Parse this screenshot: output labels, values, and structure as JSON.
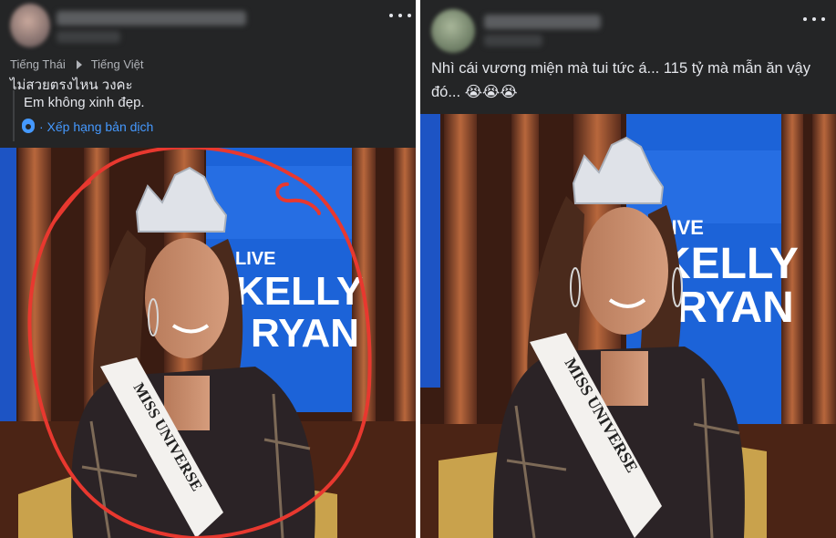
{
  "left_post": {
    "lang_from": "Tiếng Thái",
    "lang_to": "Tiếng Việt",
    "original_text": "ไม่สวยตรงไหน วงคะ",
    "translated_text": "Em không xinh đẹp.",
    "rate_translation": "· Xếp hạng bản dịch",
    "photo": {
      "backdrop_lines": [
        "LIVE",
        "KELLY",
        "RYAN"
      ],
      "sash_text": "MISS UNIVERSE"
    }
  },
  "right_post": {
    "post_text": "Nhì cái vương miện mà tui tức á... 115 tỷ mà mẫn ăn vậy đó... 😭😭😭",
    "photo": {
      "backdrop_lines": [
        "LIVE",
        "KELLY",
        "RYAN"
      ],
      "sash_text": "MISS UNIVERSE"
    }
  },
  "colors": {
    "post_bg": "#242526",
    "text": "#e4e6eb",
    "link_blue": "#4599ff",
    "annotation_circle": "#e8382f",
    "backdrop_blue": "#1c63d8"
  },
  "icons": [
    "more-options-icon",
    "forward-arrow-icon",
    "gear-icon"
  ]
}
